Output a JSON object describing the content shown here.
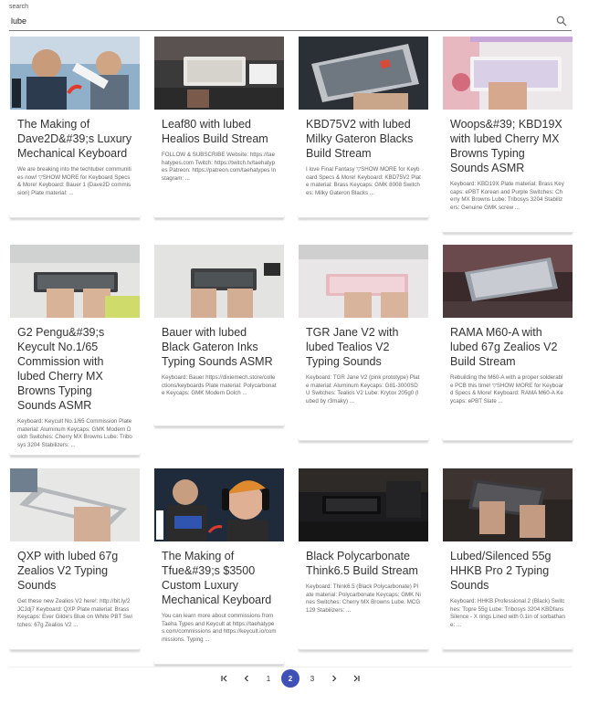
{
  "search": {
    "label": "search",
    "value": "lube",
    "icon": "search-icon"
  },
  "cards": [
    {
      "title": "The Making of Dave2D&#39;s Luxury Mechanical Keyboard",
      "desc": "We are breaking into the techtuber communities now! ▽SHOW MORE for Keyboard Specs & More! Keyboard: Bauer 1 (Dave2D commission) Plate material: ..."
    },
    {
      "title": "Leaf80 with lubed Healios Build Stream",
      "desc": "FOLLOW & SUBSCRIBE Website: https://taehatypes.com Twitch: https://twitch.tv/taehatypes Patreon: https://patreon.com/taehatypes Instagram: ..."
    },
    {
      "title": "KBD75V2 with lubed Milky Gateron Blacks Build Stream",
      "desc": "I love Final Fantasy ▽SHOW MORE for Keyboard Specs & More! Keyboard: KBD75V2 Plate material: Brass Keycaps: GMK 8008 Switches: Milky Gateron Blacks ..."
    },
    {
      "title": "Woops&#39; KBD19X with lubed Cherry MX Browns Typing Sounds ASMR",
      "desc": "Keyboard: KBD19X Plate material: Brass Keycaps: ePBT Korean and Purple Switches: Cherry MX Browns Lube: Tribosys 3204 Stabilizers: Genuine GMK screw ..."
    },
    {
      "title": "G2 Pengu&#39;s Keycult No.1/65 Commission with lubed Cherry MX Browns Typing Sounds ASMR",
      "desc": "Keyboard: Keycult No.1/65 Commission Plate material: Aluminum Keycaps: GMK Modern Dolch Switches: Cherry MX Browns Lube: Tribosys 3204 Stabilizers: ..."
    },
    {
      "title": "Bauer with lubed Black Gateron Inks Typing Sounds ASMR",
      "desc": "Keyboard: Bauer https://dixiemech.store/collections/keyboards Plate material: Polycarbonate Keycaps: GMK Modern Dolch ..."
    },
    {
      "title": "TGR Jane V2 with lubed Tealios V2 Typing Sounds",
      "desc": "Keyboard: TGR Jane V2 (pink prototype) Plate material: Aluminum Keycaps: G81-3000SDU Switches: Tealios V2 Lube: Krytox 205g0 (lubed by r3maky) ..."
    },
    {
      "title": "RAMA M60-A with lubed 67g Zealios V2 Build Stream",
      "desc": "Rebuilding the M60-A with a proper solderable PCB this time! ▽SHOW MORE for Keyboard Specs & More! Keyboard: RAMA M60-A Keycaps: ePBT Slate ..."
    },
    {
      "title": "QXP with lubed 67g Zealios V2 Typing Sounds",
      "desc": "Get these new Zealios V2 here!: http://bit.ly/2JCJdj7 Keyboard: QXP Plate material: Brass Keycaps: Ever Gilde's Blue on White PBT Switches: 67g Zealios V2 ..."
    },
    {
      "title": "The Making of Tfue&#39;s $3500 Custom Luxury Mechanical Keyboard",
      "desc": "You can learn more about commissions from Taeha Types and Keycult at https://taehatypes.com/commissions and https://keycult.io/commissions. Typing ..."
    },
    {
      "title": "Black Polycarbonate Think6.5 Build Stream",
      "desc": "Keyboard: Think6.5 (Black Polycarbonate) Plate material: Polycarbonate Keycaps: GMK Nines Switches: Cherry MX Browns Lube: MCG 129 Stabilizers: ..."
    },
    {
      "title": "Lubed/Silenced 55g HHKB Pro 2 Typing Sounds",
      "desc": "Keyboard: HHKB Professional 2 (Black) Switches: Topre 55g Lube: Tribosys 3204 KBDfans Silence - X rings Lined with 0.1in of sorbathane: ..."
    }
  ],
  "pagination": {
    "first_icon": "first-page-icon",
    "prev_icon": "chevron-left-icon",
    "pages": [
      "1",
      "2",
      "3"
    ],
    "current": "2",
    "next_icon": "chevron-right-icon",
    "last_icon": "last-page-icon",
    "accent": "#3f51b5"
  }
}
